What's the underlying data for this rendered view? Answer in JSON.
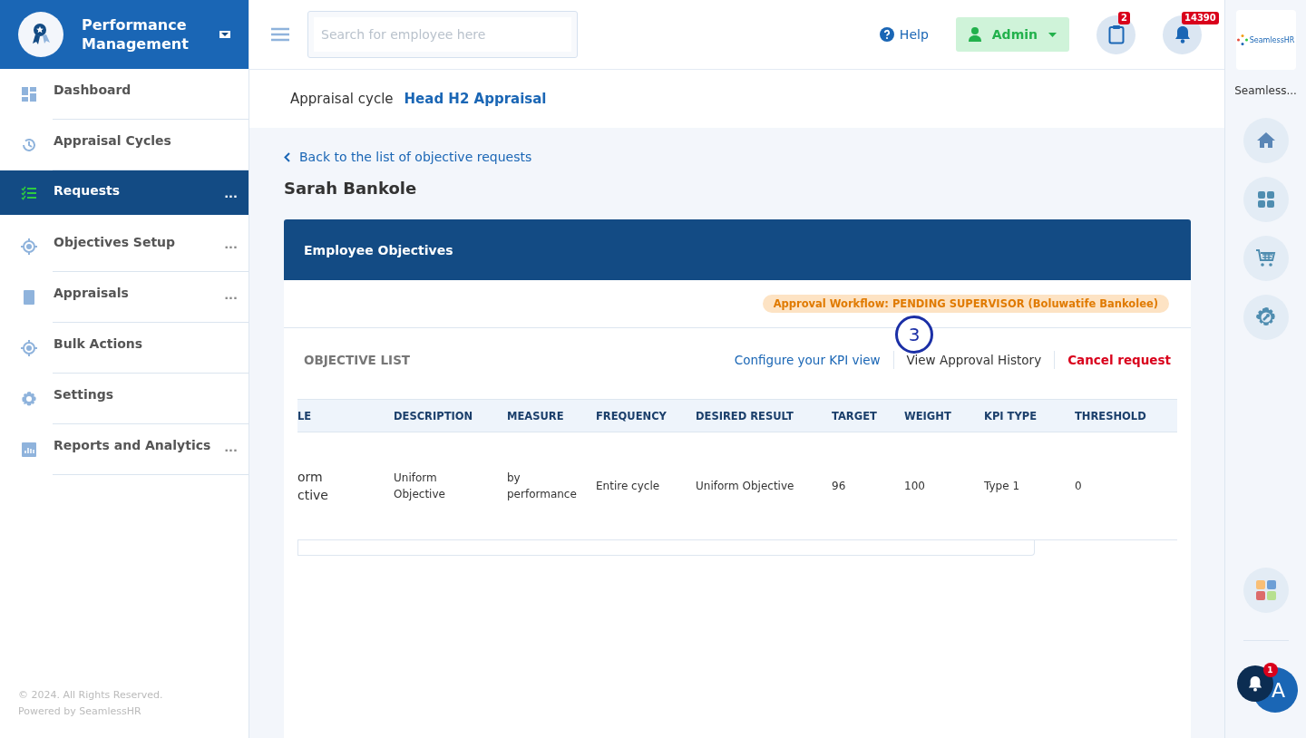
{
  "app": {
    "title": "Performance Management"
  },
  "sidebar": {
    "items": [
      {
        "label": "Dashboard",
        "selected": false
      },
      {
        "label": "Appraisal Cycles",
        "selected": false
      },
      {
        "label": "Requests",
        "selected": true,
        "menu": "..."
      },
      {
        "label": "Objectives Setup",
        "selected": false,
        "menu": "..."
      },
      {
        "label": "Appraisals",
        "selected": false,
        "menu": "..."
      },
      {
        "label": "Bulk Actions",
        "selected": false
      },
      {
        "label": "Settings",
        "selected": false
      },
      {
        "label": "Reports and Analytics",
        "selected": false,
        "menu": "..."
      }
    ],
    "footer": [
      "© 2024. All Rights Reserved.",
      "Powered by SeamlessHR"
    ]
  },
  "topbar": {
    "search": {
      "placeholder": "Search for employee here"
    },
    "help": "Help",
    "user": "Admin",
    "tasks_badge": "2",
    "notifications_badge": "14390"
  },
  "appraisal_cycle": {
    "label": "Appraisal cycle",
    "value": "Head H2 Appraisal"
  },
  "back_link": "Back to the list of objective requests",
  "employee_name": "Sarah Bankole",
  "card": {
    "title": "Employee Objectives",
    "workflow_status": "Approval Workflow: PENDING SUPERVISOR (Boluwatife Bankolee)",
    "section_title": "OBJECTIVE LIST",
    "actions": [
      {
        "label": "Configure your KPI view",
        "kind": "link"
      },
      {
        "label": "View Approval History",
        "kind": "plain"
      },
      {
        "label": "Cancel request",
        "kind": "danger"
      }
    ],
    "step_marker": "3",
    "table": {
      "columns": [
        "LE",
        "DESCRIPTION",
        "MEASURE",
        "FREQUENCY",
        "DESIRED RESULT",
        "TARGET",
        "WEIGHT",
        "KPI TYPE",
        "THRESHOLD"
      ],
      "rows": [
        [
          "orm ctive",
          "Uniform Objective",
          "by performance",
          "Entire cycle",
          "Uniform Objective",
          "96",
          "100",
          "Type 1",
          "0"
        ]
      ]
    }
  },
  "rail": {
    "logo": "SeamlessHR",
    "company": "Seamless...",
    "notification_badge": "1",
    "avatar": "A"
  }
}
